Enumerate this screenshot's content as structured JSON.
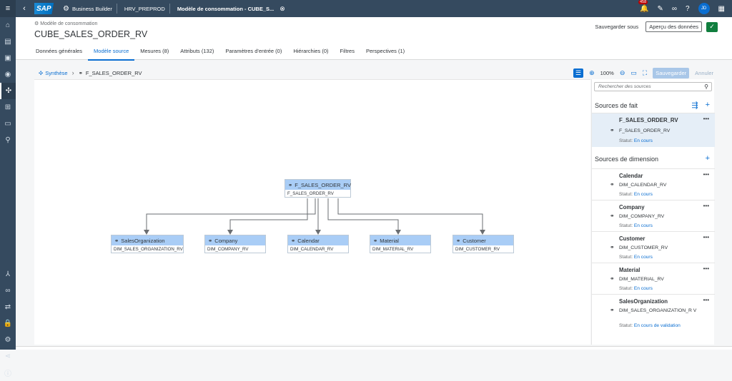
{
  "shell": {
    "logo": "SAP",
    "app": "Business Builder",
    "space": "HRV_PREPROD",
    "tab": "Modèle de consommation - CUBE_S...",
    "notifications": "458",
    "avatar": "JD"
  },
  "header": {
    "subtitle": "Modèle de consommation",
    "title": "CUBE_SALES_ORDER_RV",
    "save_as": "Sauvegarder sous",
    "preview": "Aperçu des données"
  },
  "tabs": [
    {
      "label": "Données générales"
    },
    {
      "label": "Modèle source"
    },
    {
      "label": "Mesures (8)"
    },
    {
      "label": "Attributs (132)"
    },
    {
      "label": "Paramètres d'entrée (0)"
    },
    {
      "label": "Hiérarchies (0)"
    },
    {
      "label": "Filtres"
    },
    {
      "label": "Perspectives (1)"
    }
  ],
  "toolbar": {
    "breadcrumb_root": "Synthèse",
    "breadcrumb_current": "F_SALES_ORDER_RV",
    "zoom": "100%",
    "save": "Sauvegarder",
    "cancel": "Annuler"
  },
  "diagram": {
    "fact": {
      "title": "F_SALES_ORDER_RV",
      "sub": "F_SALES_ORDER_RV"
    },
    "dims": [
      {
        "title": "SalesOrganization",
        "sub": "DIM_SALES_ORGANIZATION_RV"
      },
      {
        "title": "Company",
        "sub": "DIM_COMPANY_RV"
      },
      {
        "title": "Calendar",
        "sub": "DIM_CALENDAR_RV"
      },
      {
        "title": "Material",
        "sub": "DIM_MATERIAL_RV"
      },
      {
        "title": "Customer",
        "sub": "DIM_CUSTOMER_RV"
      }
    ]
  },
  "panel": {
    "search_placeholder": "Rechercher des sources",
    "fact_section": "Sources de fait",
    "dim_section": "Sources de dimension",
    "status_label": "Statut:",
    "fact_item": {
      "name": "F_SALES_ORDER_RV",
      "sub": "F_SALES_ORDER_RV",
      "status": "En cours"
    },
    "dim_items": [
      {
        "name": "Calendar",
        "sub": "DIM_CALENDAR_RV",
        "status": "En cours"
      },
      {
        "name": "Company",
        "sub": "DIM_COMPANY_RV",
        "status": "En cours"
      },
      {
        "name": "Customer",
        "sub": "DIM_CUSTOMER_RV",
        "status": "En cours"
      },
      {
        "name": "Material",
        "sub": "DIM_MATERIAL_RV",
        "status": "En cours"
      },
      {
        "name": "SalesOrganization",
        "sub": "DIM_SALES_ORGANIZATION_R V",
        "status": "En cours de validation"
      }
    ]
  }
}
